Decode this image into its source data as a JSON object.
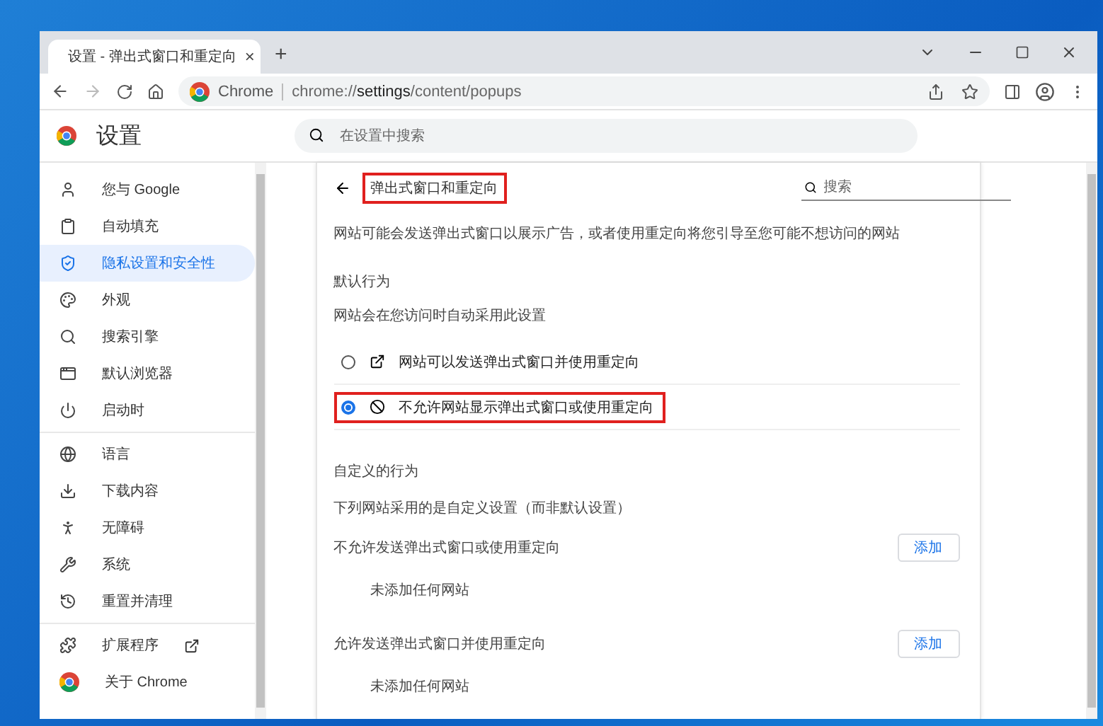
{
  "browser": {
    "tab": {
      "title": "设置 - 弹出式窗口和重定向",
      "close": "×"
    },
    "new_tab": "+",
    "address": {
      "chip": "Chrome",
      "url": "chrome://**settings**/content/popups"
    }
  },
  "header": {
    "title": "设置",
    "search": {
      "placeholder": "在设置中搜索"
    }
  },
  "sidebar": {
    "groups": [
      {
        "items": [
          {
            "label": "您与 Google",
            "selected": false
          },
          {
            "label": "自动填充",
            "selected": false
          },
          {
            "label": "隐私设置和安全性",
            "selected": true
          },
          {
            "label": "外观",
            "selected": false
          },
          {
            "label": "搜索引擎",
            "selected": false
          },
          {
            "label": "默认浏览器",
            "selected": false
          },
          {
            "label": "启动时",
            "selected": false
          }
        ]
      },
      {
        "items": [
          {
            "label": "语言",
            "selected": false
          },
          {
            "label": "下载内容",
            "selected": false
          },
          {
            "label": "无障碍",
            "selected": false
          },
          {
            "label": "系统",
            "selected": false
          },
          {
            "label": "重置并清理",
            "selected": false
          }
        ]
      },
      {
        "items": [
          {
            "label": "扩展程序",
            "selected": false,
            "external": true
          },
          {
            "label": "关于 Chrome",
            "selected": false
          }
        ]
      }
    ]
  },
  "main": {
    "title": "弹出式窗口和重定向",
    "title_highlighted": true,
    "search": {
      "placeholder": "搜索"
    },
    "description": "网站可能会发送弹出式窗口以展示广告，或者使用重定向将您引导至您可能不想访问的网站",
    "default_section": {
      "heading": "默认行为",
      "subheading": "网站会在您访问时自动采用此设置",
      "options": [
        {
          "kind": "allow",
          "label": "网站可以发送弹出式窗口并使用重定向",
          "selected": false,
          "highlighted": false
        },
        {
          "kind": "block",
          "label": "不允许网站显示弹出式窗口或使用重定向",
          "selected": true,
          "highlighted": true
        }
      ]
    },
    "custom_section": {
      "heading": "自定义的行为",
      "subheading": "下列网站采用的是自定义设置（而非默认设置）",
      "groups": [
        {
          "label": "不允许发送弹出式窗口或使用重定向",
          "button": "添加",
          "empty": "未添加任何网站"
        },
        {
          "label": "允许发送弹出式窗口并使用重定向",
          "button": "添加",
          "empty": "未添加任何网站"
        }
      ]
    }
  }
}
